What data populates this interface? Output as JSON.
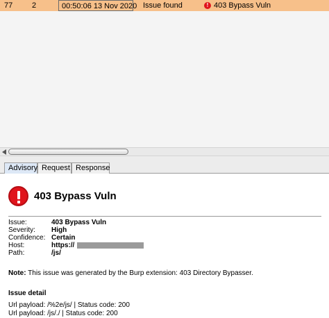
{
  "issue_row": {
    "number": "77",
    "tool": "2",
    "time": "00:50:06 13 Nov 2020",
    "type": "Issue found",
    "issue": "403 Bypass Vuln",
    "color": "#f7c08a"
  },
  "tabs": [
    {
      "label": "Advisory",
      "active": true
    },
    {
      "label": "Request",
      "active": false
    },
    {
      "label": "Response",
      "active": false
    }
  ],
  "advisory": {
    "icon": "alert-icon",
    "title": "403 Bypass Vuln",
    "fields": [
      {
        "label": "Issue:",
        "value": "403 Bypass Vuln"
      },
      {
        "label": "Severity:",
        "value": "High"
      },
      {
        "label": "Confidence:",
        "value": "Certain"
      },
      {
        "label": "Host:",
        "value": "https://"
      },
      {
        "label": "Path:",
        "value": "/js/"
      }
    ],
    "note_label": "Note:",
    "note_text": " This issue was generated by the Burp extension: 403 Directory Bypasser.",
    "detail_heading": "Issue detail",
    "payloads": [
      "Url payload: /%2e/js/ | Status code: 200",
      "Url payload: /js/./ | Status code: 200"
    ]
  }
}
